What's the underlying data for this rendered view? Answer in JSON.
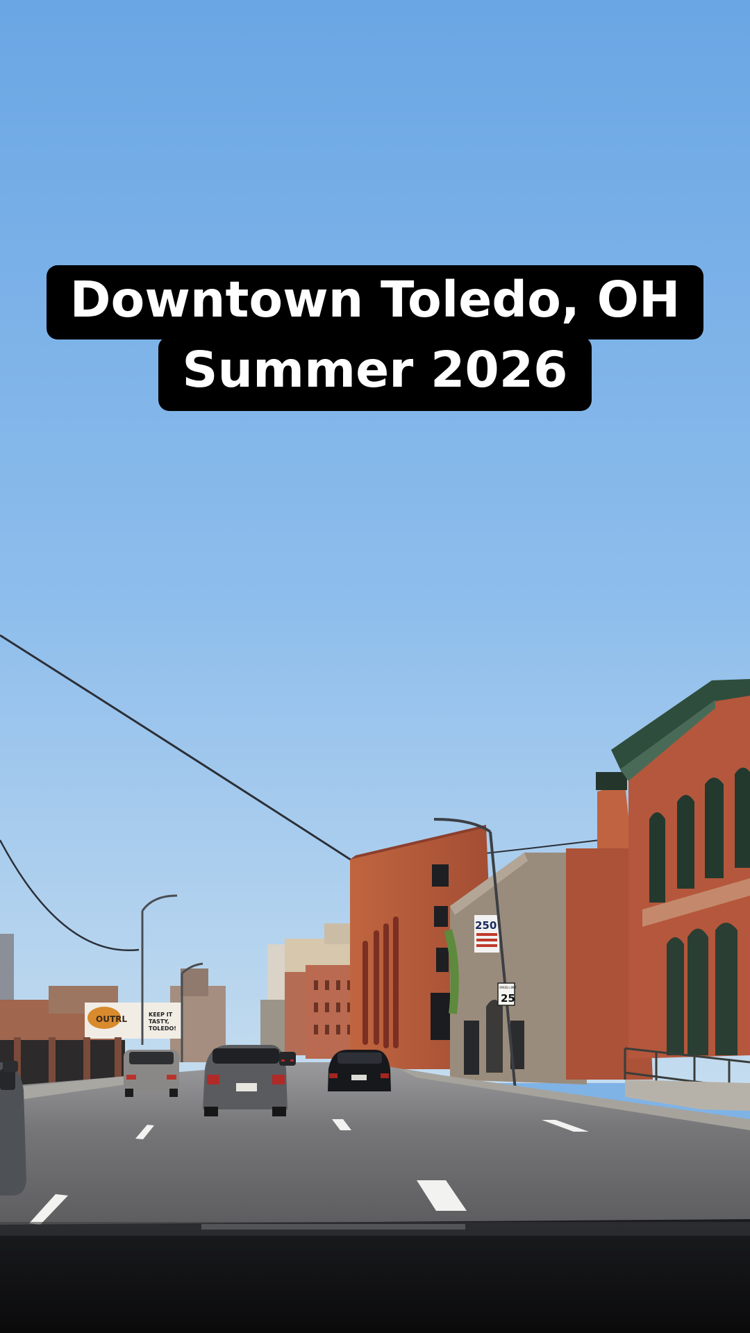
{
  "caption": {
    "line1": "Downtown Toledo, OH",
    "line2": "Summer 2026"
  },
  "signage": {
    "speed_limit_top": "SPEED LIMIT",
    "speed_limit_value": "25",
    "banner_number": "250",
    "billboard_brand": "OUTRL",
    "billboard_text": "KEEP IT TASTY, TOLEDO!"
  },
  "colors": {
    "sky_top": "#6aa6e4",
    "sky_bottom": "#c4dcef",
    "brick": "#b5573c",
    "brick_dark": "#8c3f2c",
    "stone": "#9a8c7c",
    "trim_green": "#2f4d3c",
    "road": "#6d6d6f",
    "dashboard": "#111214",
    "caption_bg": "#000000",
    "caption_text": "#ffffff"
  }
}
